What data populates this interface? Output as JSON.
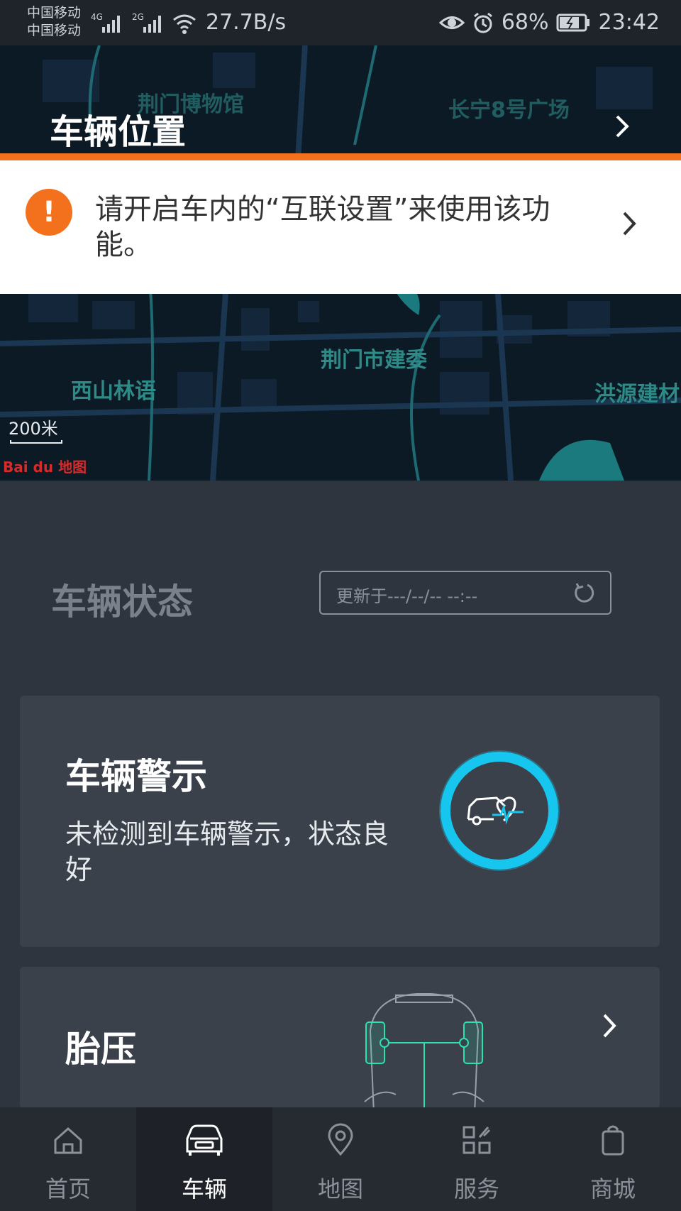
{
  "status_bar": {
    "carrier_1": "中国移动",
    "carrier_2": "中国移动",
    "net_1": "4G",
    "net_2": "2G",
    "net_speed": "27.7B/s",
    "battery": "68%",
    "time": "23:42"
  },
  "map": {
    "labels": [
      "荆门博物馆",
      "长宁8号广场",
      "荆门市建委",
      "西山林语",
      "洪源建材"
    ],
    "scale": "200米",
    "brand": "Bai du 地图"
  },
  "location": {
    "title": "车辆位置"
  },
  "notice": {
    "text": "请开启车内的“互联设置”来使用该功能。",
    "icon": "!"
  },
  "vehicle_status": {
    "title": "车辆状态",
    "update_text": "更新于---/--/-- --:--"
  },
  "warning_card": {
    "title": "车辆警示",
    "description": "未检测到车辆警示，状态良好"
  },
  "tire_card": {
    "title": "胎压"
  },
  "bottom_nav": {
    "items": [
      {
        "label": "首页",
        "icon": "home-icon"
      },
      {
        "label": "车辆",
        "icon": "car-icon"
      },
      {
        "label": "地图",
        "icon": "map-pin-icon"
      },
      {
        "label": "服务",
        "icon": "services-icon"
      },
      {
        "label": "商城",
        "icon": "shopping-bag-icon"
      }
    ],
    "active_index": 1
  },
  "colors": {
    "accent_orange": "#f3701c",
    "ring_cyan": "#17c6ef",
    "tire_green": "#2de0b0"
  }
}
